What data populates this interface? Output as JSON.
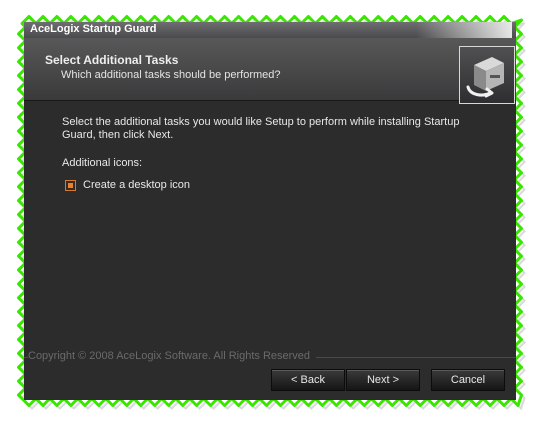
{
  "window": {
    "title": "AceLogix Startup Guard"
  },
  "header": {
    "title": "Select Additional Tasks",
    "subtitle": "Which additional tasks should be performed?",
    "image_icon": "installer-box-icon"
  },
  "content": {
    "description": "Select the additional tasks you would like Setup to perform while installing Startup Guard, then click Next.",
    "section_label": "Additional icons:",
    "tasks": [
      {
        "label": "Create a desktop icon",
        "checked": true
      }
    ]
  },
  "footer": {
    "copyright": "Copyright © 2008 AceLogix Software. All Rights Reserved",
    "back_label": "< Back",
    "next_label": "Next >",
    "cancel_label": "Cancel"
  },
  "colors": {
    "window_bg": "#2c2c2d",
    "accent": "#e8822f",
    "frame_glow": "#39e600"
  }
}
